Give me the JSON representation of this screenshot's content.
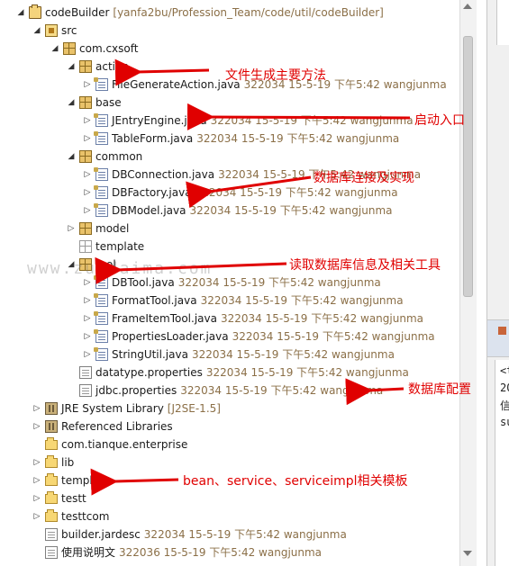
{
  "tree": {
    "rows": [
      {
        "label": "codeBuilder",
        "meta": "[yanfa2bu/Profession_Team/code/util/codeBuilder]",
        "twisty": "open",
        "icon": "project-icon"
      },
      {
        "label": "src",
        "meta": "",
        "twisty": "open",
        "icon": "source-folder-icon"
      },
      {
        "label": "com.cxsoft",
        "meta": "",
        "twisty": "open",
        "icon": "package-icon"
      },
      {
        "label": "action",
        "meta": "",
        "twisty": "open",
        "icon": "package-icon"
      },
      {
        "label": "FileGenerateAction.java",
        "meta": "322034   15-5-19 下午5:42   wangjunma",
        "twisty": "closed",
        "icon": "java-file-icon"
      },
      {
        "label": "base",
        "meta": "",
        "twisty": "open",
        "icon": "package-icon"
      },
      {
        "label": "JEntryEngine.java",
        "meta": "322034   15-5-19 下午5:42   wangjunma",
        "twisty": "closed",
        "icon": "java-file-icon"
      },
      {
        "label": "TableForm.java",
        "meta": "322034   15-5-19 下午5:42   wangjunma",
        "twisty": "closed",
        "icon": "java-file-icon"
      },
      {
        "label": "common",
        "meta": "",
        "twisty": "open",
        "icon": "package-icon"
      },
      {
        "label": "DBConnection.java",
        "meta": "322034   15-5-19 下午5:42   wangjunma",
        "twisty": "closed",
        "icon": "java-file-icon"
      },
      {
        "label": "DBFactory.java",
        "meta": "322034   15-5-19 下午5:42   wangjunma",
        "twisty": "closed",
        "icon": "java-file-icon"
      },
      {
        "label": "DBModel.java",
        "meta": "322034   15-5-19 下午5:42   wangjunma",
        "twisty": "closed",
        "icon": "java-file-icon"
      },
      {
        "label": "model",
        "meta": "",
        "twisty": "closed",
        "icon": "package-icon"
      },
      {
        "label": "template",
        "meta": "",
        "twisty": "none",
        "icon": "empty-package-icon"
      },
      {
        "label": "tool",
        "meta": "",
        "twisty": "open",
        "icon": "package-icon"
      },
      {
        "label": "DBTool.java",
        "meta": "322034   15-5-19 下午5:42   wangjunma",
        "twisty": "closed",
        "icon": "java-file-icon"
      },
      {
        "label": "FormatTool.java",
        "meta": "322034   15-5-19 下午5:42   wangjunma",
        "twisty": "closed",
        "icon": "java-file-icon"
      },
      {
        "label": "FrameItemTool.java",
        "meta": "322034   15-5-19 下午5:42   wangjunma",
        "twisty": "closed",
        "icon": "java-file-icon"
      },
      {
        "label": "PropertiesLoader.java",
        "meta": "322034   15-5-19 下午5:42   wangjunma",
        "twisty": "closed",
        "icon": "java-file-icon"
      },
      {
        "label": "StringUtil.java",
        "meta": "322034   15-5-19 下午5:42   wangjunma",
        "twisty": "closed",
        "icon": "java-file-icon"
      },
      {
        "label": "datatype.properties",
        "meta": "322034   15-5-19 下午5:42   wangjunma",
        "twisty": "none",
        "icon": "properties-file-icon"
      },
      {
        "label": "jdbc.properties",
        "meta": "322034   15-5-19 下午5:42   wangjunma",
        "twisty": "none",
        "icon": "properties-file-icon"
      },
      {
        "label": "JRE System Library",
        "meta": "[J2SE-1.5]",
        "twisty": "closed",
        "icon": "library-icon"
      },
      {
        "label": "Referenced Libraries",
        "meta": "",
        "twisty": "closed",
        "icon": "library-icon"
      },
      {
        "label": "com.tianque.enterprise",
        "meta": "",
        "twisty": "none",
        "icon": "folder-icon"
      },
      {
        "label": "lib",
        "meta": "",
        "twisty": "closed",
        "icon": "folder-icon"
      },
      {
        "label": "template",
        "meta": "",
        "twisty": "closed",
        "icon": "folder-icon"
      },
      {
        "label": "testt",
        "meta": "",
        "twisty": "closed",
        "icon": "folder-icon"
      },
      {
        "label": "testtcom",
        "meta": "",
        "twisty": "closed",
        "icon": "folder-icon"
      },
      {
        "label": "builder.jardesc",
        "meta": "322034   15-5-19 下午5:42   wangjunma",
        "twisty": "none",
        "icon": "file-icon"
      },
      {
        "label": "使用说明文",
        "meta": "322036   15-5-19 下午5:42   wangjunma",
        "twisty": "none",
        "icon": "file-icon"
      }
    ]
  },
  "annotations": {
    "a1": "文件生成主要方法",
    "a2": "启动入口",
    "a3": "数据库连接及实现",
    "a4": "读取数据库信息及相关工具",
    "a5": "数据库配置",
    "a6": "bean、service、serviceimpl相关模板"
  },
  "watermark": "www.zuidaima.com",
  "right_panel": {
    "line1": "<t",
    "line2": "20",
    "line3": "信",
    "line4": "su"
  },
  "colors": {
    "annotation": "#e00000",
    "meta_text": "#8b6f47"
  }
}
